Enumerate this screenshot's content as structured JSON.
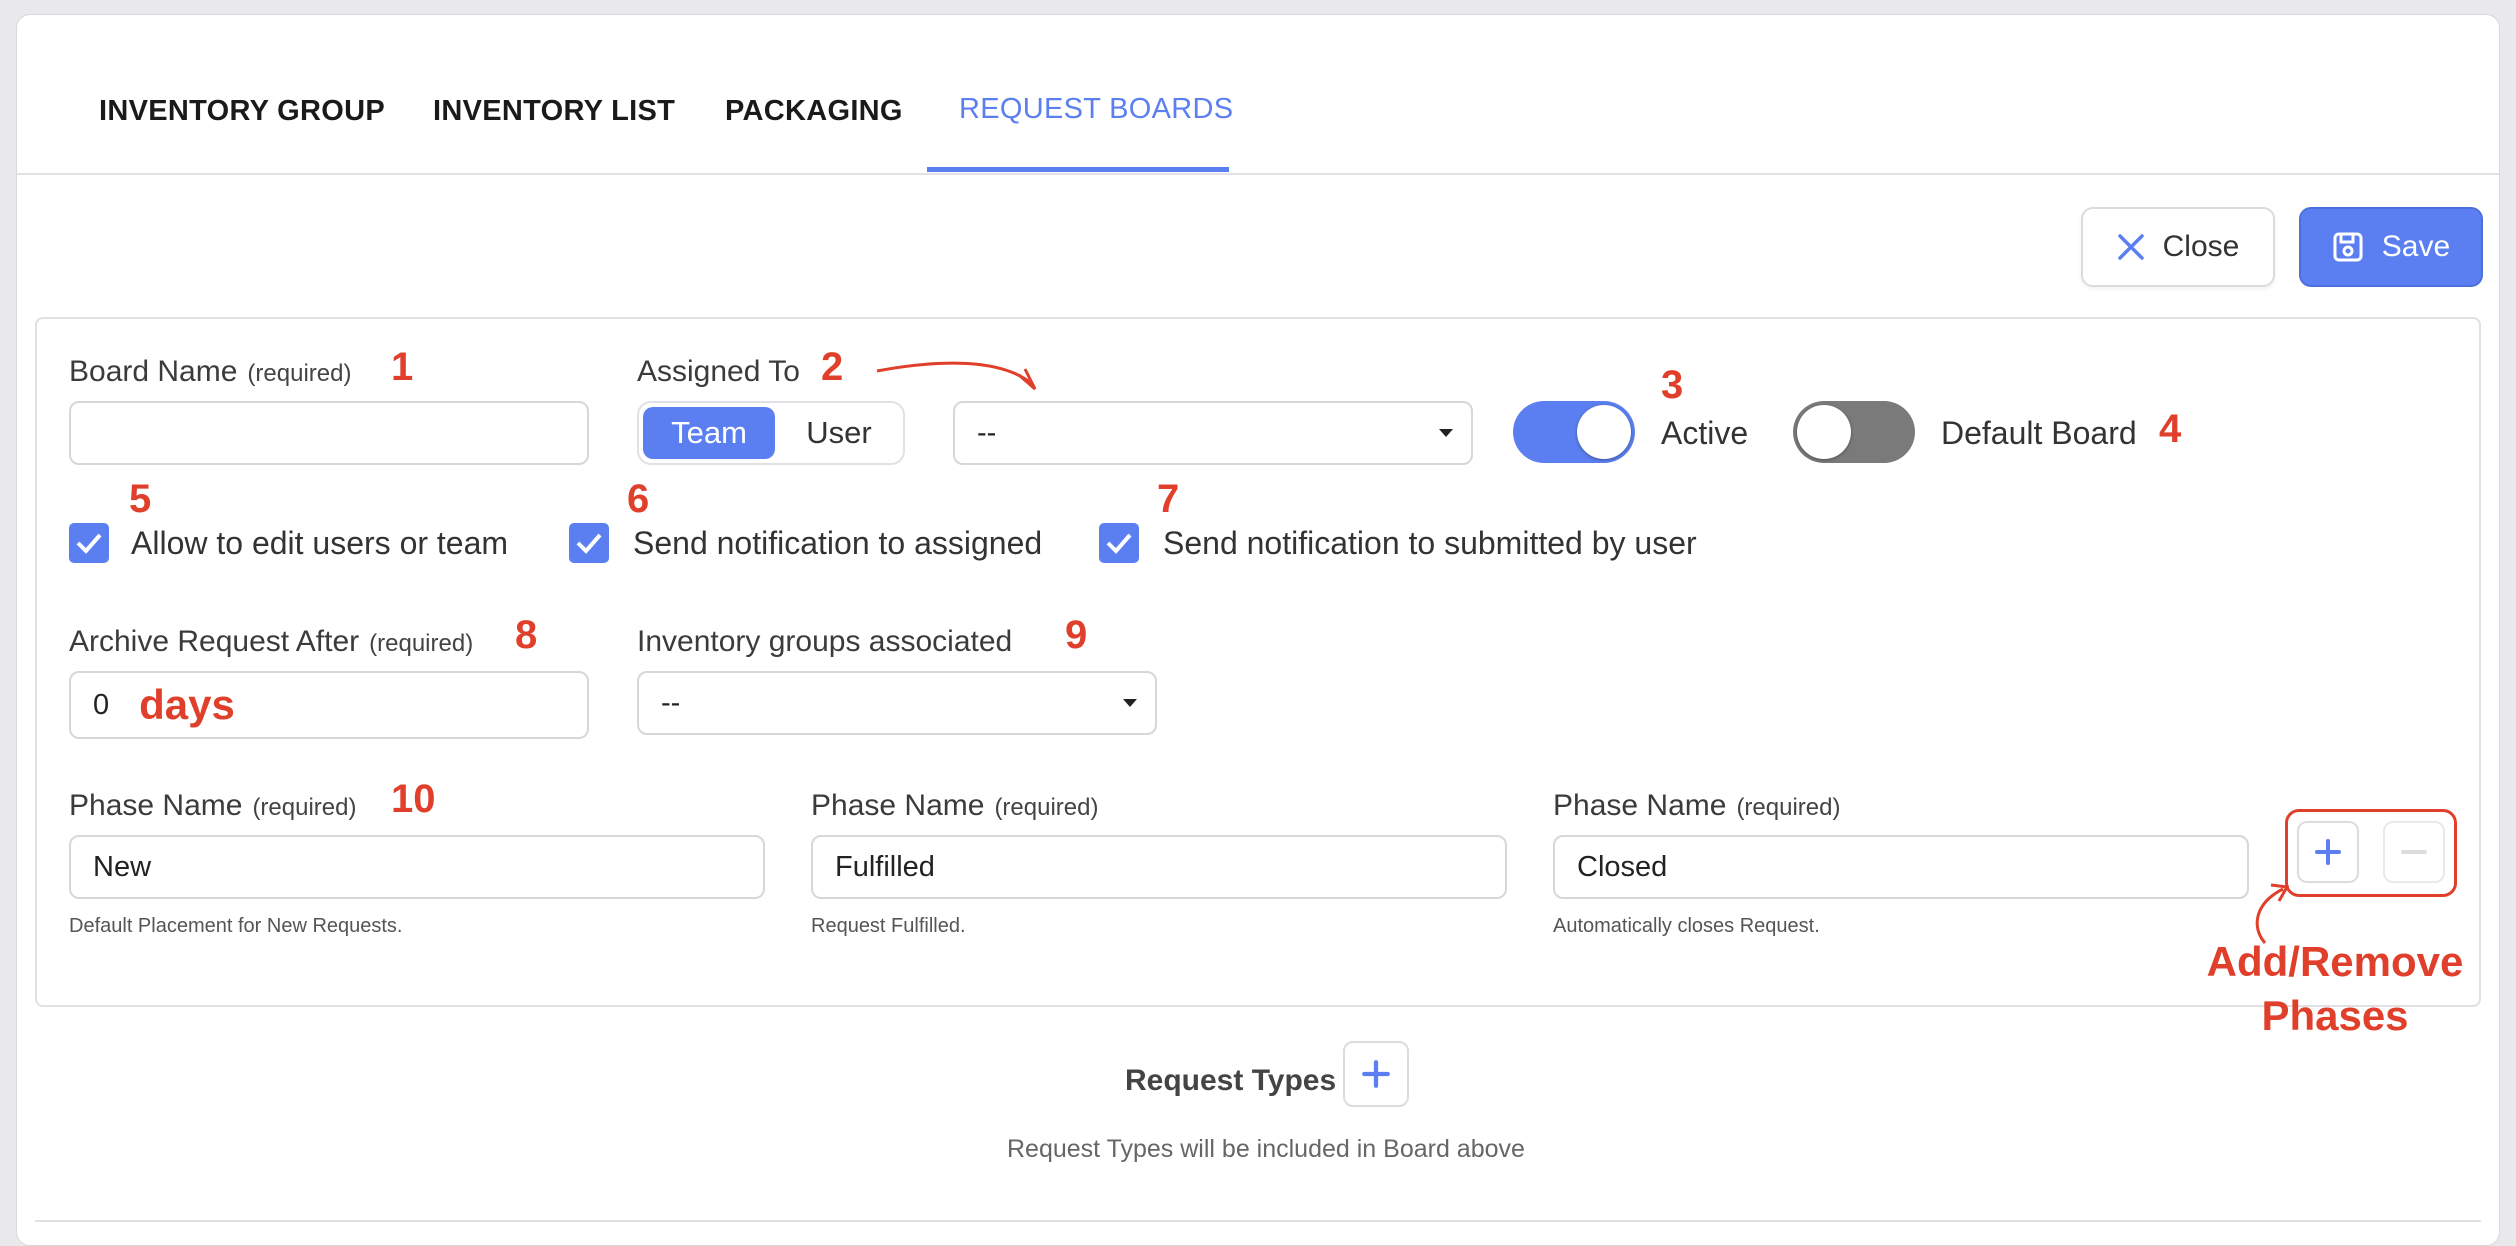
{
  "tabs": [
    {
      "label": "INVENTORY GROUP"
    },
    {
      "label": "INVENTORY LIST"
    },
    {
      "label": "PACKAGING"
    },
    {
      "label": "REQUEST BOARDS",
      "active": true
    }
  ],
  "toolbar": {
    "close_label": "Close",
    "save_label": "Save"
  },
  "form": {
    "board_name": {
      "label": "Board Name",
      "required": "(required)",
      "value": ""
    },
    "assigned_to": {
      "label": "Assigned To",
      "segments": [
        "Team",
        "User"
      ],
      "selected": "Team",
      "select_value": "--"
    },
    "active": {
      "label": "Active",
      "on": true
    },
    "default_board": {
      "label": "Default Board",
      "on": false
    },
    "checkboxes": [
      {
        "label": "Allow to edit users or team",
        "checked": true
      },
      {
        "label": "Send notification to assigned",
        "checked": true
      },
      {
        "label": "Send notification to submitted by user",
        "checked": true
      }
    ],
    "archive": {
      "label": "Archive Request After",
      "required": "(required)",
      "value": "0"
    },
    "inventory_groups": {
      "label": "Inventory groups associated",
      "value": "--"
    },
    "phases": [
      {
        "label": "Phase Name",
        "required": "(required)",
        "value": "New",
        "hint": "Default Placement for New Requests."
      },
      {
        "label": "Phase Name",
        "required": "(required)",
        "value": "Fulfilled",
        "hint": "Request Fulfilled."
      },
      {
        "label": "Phase Name",
        "required": "(required)",
        "value": "Closed",
        "hint": "Automatically closes Request."
      }
    ]
  },
  "request_types": {
    "title": "Request Types",
    "subtitle": "Request Types will be included in Board above"
  },
  "annotations": {
    "n1": "1",
    "n2": "2",
    "n3": "3",
    "n4": "4",
    "n5": "5",
    "n6": "6",
    "n7": "7",
    "n8": "8",
    "n9": "9",
    "n10": "10",
    "days": "days",
    "add_remove_line1": "Add/Remove",
    "add_remove_line2": "Phases"
  },
  "colors": {
    "accent": "#5b7ff0",
    "annotation": "#e0402b",
    "toggle_off": "#7a7a7a"
  }
}
